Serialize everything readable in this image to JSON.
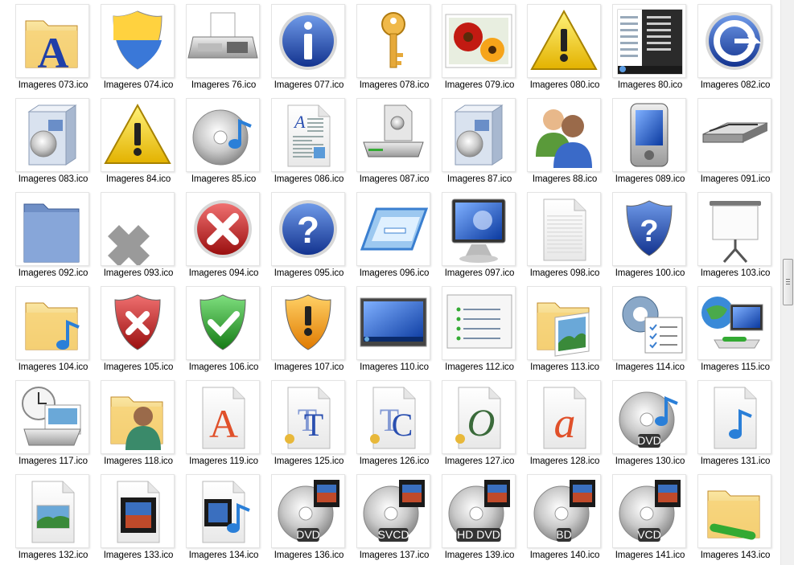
{
  "view": {
    "items": [
      {
        "label": "Imageres 073.ico",
        "icon": "folder-font-icon"
      },
      {
        "label": "Imageres 074.ico",
        "icon": "shield-uac-icon"
      },
      {
        "label": "Imageres 76.ico",
        "icon": "fax-icon"
      },
      {
        "label": "Imageres 077.ico",
        "icon": "info-icon"
      },
      {
        "label": "Imageres 078.ico",
        "icon": "key-icon"
      },
      {
        "label": "Imageres 079.ico",
        "icon": "flowers-picture-icon"
      },
      {
        "label": "Imageres 080.ico",
        "icon": "warning-icon"
      },
      {
        "label": "Imageres 80.ico",
        "icon": "start-menu-icon"
      },
      {
        "label": "Imageres 082.ico",
        "icon": "sync-arrow-icon"
      },
      {
        "label": "Imageres 083.ico",
        "icon": "software-box-icon"
      },
      {
        "label": "Imageres 84.ico",
        "icon": "warning-icon"
      },
      {
        "label": "Imageres 85.ico",
        "icon": "music-disc-icon"
      },
      {
        "label": "Imageres 086.ico",
        "icon": "document-icon"
      },
      {
        "label": "Imageres 087.ico",
        "icon": "drive-install-icon"
      },
      {
        "label": "Imageres 87.ico",
        "icon": "software-box-icon"
      },
      {
        "label": "Imageres 88.ico",
        "icon": "users-icon"
      },
      {
        "label": "Imageres 089.ico",
        "icon": "pda-icon"
      },
      {
        "label": "Imageres 091.ico",
        "icon": "scanner-icon"
      },
      {
        "label": "Imageres 092.ico",
        "icon": "blue-folder-icon"
      },
      {
        "label": "Imageres 093.ico",
        "icon": "gray-x-icon"
      },
      {
        "label": "Imageres 094.ico",
        "icon": "error-icon"
      },
      {
        "label": "Imageres 095.ico",
        "icon": "help-icon"
      },
      {
        "label": "Imageres 096.ico",
        "icon": "window-tilt-icon"
      },
      {
        "label": "Imageres 097.ico",
        "icon": "monitor-icon"
      },
      {
        "label": "Imageres 098.ico",
        "icon": "blank-file-icon"
      },
      {
        "label": "Imageres 100.ico",
        "icon": "shield-help-icon"
      },
      {
        "label": "Imageres 103.ico",
        "icon": "projector-screen-icon"
      },
      {
        "label": "Imageres 104.ico",
        "icon": "music-folder-icon"
      },
      {
        "label": "Imageres 105.ico",
        "icon": "shield-error-icon"
      },
      {
        "label": "Imageres 106.ico",
        "icon": "shield-ok-icon"
      },
      {
        "label": "Imageres 107.ico",
        "icon": "shield-warning-icon"
      },
      {
        "label": "Imageres 110.ico",
        "icon": "desktop-icon"
      },
      {
        "label": "Imageres 112.ico",
        "icon": "list-window-icon"
      },
      {
        "label": "Imageres 113.ico",
        "icon": "pictures-folder-icon"
      },
      {
        "label": "Imageres 114.ico",
        "icon": "settings-list-icon"
      },
      {
        "label": "Imageres 115.ico",
        "icon": "network-icon"
      },
      {
        "label": "Imageres 117.ico",
        "icon": "scheduled-icon"
      },
      {
        "label": "Imageres 118.ico",
        "icon": "user-folder-icon"
      },
      {
        "label": "Imageres 119.ico",
        "icon": "font-a-icon"
      },
      {
        "label": "Imageres 125.ico",
        "icon": "truetype-font-icon"
      },
      {
        "label": "Imageres 126.ico",
        "icon": "truetype-collection-icon"
      },
      {
        "label": "Imageres 127.ico",
        "icon": "opentype-font-icon"
      },
      {
        "label": "Imageres 128.ico",
        "icon": "font-script-a-icon"
      },
      {
        "label": "Imageres 130.ico",
        "icon": "dvd-audio-icon",
        "badge": "DVD"
      },
      {
        "label": "Imageres 131.ico",
        "icon": "audio-file-icon"
      },
      {
        "label": "Imageres 132.ico",
        "icon": "image-file-icon"
      },
      {
        "label": "Imageres 133.ico",
        "icon": "video-file-icon"
      },
      {
        "label": "Imageres 134.ico",
        "icon": "media-file-icon"
      },
      {
        "label": "Imageres 136.ico",
        "icon": "dvd-video-icon",
        "badge": "DVD"
      },
      {
        "label": "Imageres 137.ico",
        "icon": "svcd-icon",
        "badge": "SVCD"
      },
      {
        "label": "Imageres 139.ico",
        "icon": "hd-dvd-icon",
        "badge": "HD DVD"
      },
      {
        "label": "Imageres 140.ico",
        "icon": "bd-icon",
        "badge": "BD"
      },
      {
        "label": "Imageres 141.ico",
        "icon": "vcd-icon",
        "badge": "VCD"
      },
      {
        "label": "Imageres 143.ico",
        "icon": "network-folder-icon"
      }
    ]
  }
}
